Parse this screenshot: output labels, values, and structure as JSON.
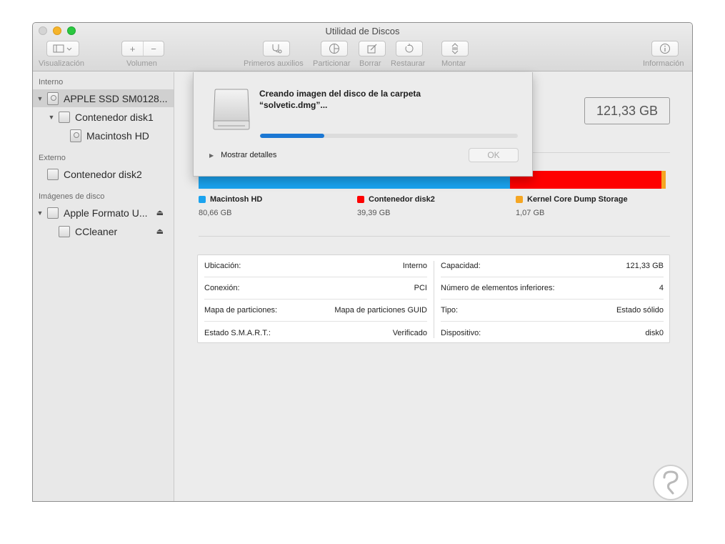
{
  "window": {
    "title": "Utilidad de Discos"
  },
  "toolbar": {
    "view_label": "Visualización",
    "volume_label": "Volumen",
    "volume_add": "+",
    "volume_remove": "−",
    "first_aid_label": "Primeros auxilios",
    "partition_label": "Particionar",
    "erase_label": "Borrar",
    "restore_label": "Restaurar",
    "mount_label": "Montar",
    "info_label": "Información"
  },
  "sidebar": {
    "sections": {
      "internal": "Interno",
      "external": "Externo",
      "images": "Imágenes de disco"
    },
    "items": [
      {
        "label": "APPLE SSD SM0128..."
      },
      {
        "label": "Contenedor disk1"
      },
      {
        "label": "Macintosh HD"
      },
      {
        "label": "Contenedor disk2"
      },
      {
        "label": "Apple Formato U..."
      },
      {
        "label": "CCleaner"
      }
    ],
    "eject_glyph": "⏏"
  },
  "main": {
    "capacity_display": "121,33 GB",
    "usage": [
      {
        "name": "Macintosh HD",
        "size": "80,66 GB",
        "color": "#1aa3ef",
        "gb": 80.66
      },
      {
        "name": "Contenedor disk2",
        "size": "39,39 GB",
        "color": "#fe0000",
        "gb": 39.39
      },
      {
        "name": "Kernel Core Dump Storage",
        "size": "1,07 GB",
        "color": "#f5a623",
        "gb": 1.07
      }
    ],
    "info": {
      "left": [
        {
          "key": "Ubicación:",
          "value": "Interno"
        },
        {
          "key": "Conexión:",
          "value": "PCI"
        },
        {
          "key": "Mapa de particiones:",
          "value": "Mapa de particiones GUID"
        },
        {
          "key": "Estado S.M.A.R.T.:",
          "value": "Verificado"
        }
      ],
      "right": [
        {
          "key": "Capacidad:",
          "value": "121,33 GB"
        },
        {
          "key": "Número de elementos inferiores:",
          "value": "4"
        },
        {
          "key": "Tipo:",
          "value": "Estado sólido"
        },
        {
          "key": "Dispositivo:",
          "value": "disk0"
        }
      ]
    }
  },
  "sheet": {
    "title": "Creando imagen del disco de la carpeta\n“solvetic.dmg”...",
    "progress": 0.25,
    "details_label": "Mostrar detalles",
    "ok_label": "OK"
  }
}
